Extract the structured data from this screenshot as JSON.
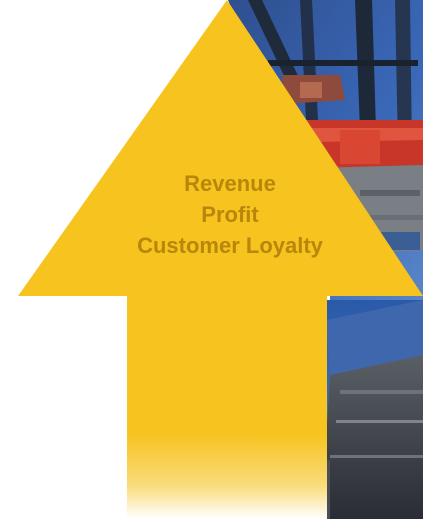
{
  "graphic": {
    "lines": [
      "Revenue",
      "Profit",
      "Customer Loyalty"
    ],
    "arrow_color": "#f7c31f",
    "text_color": "#b8860b"
  }
}
